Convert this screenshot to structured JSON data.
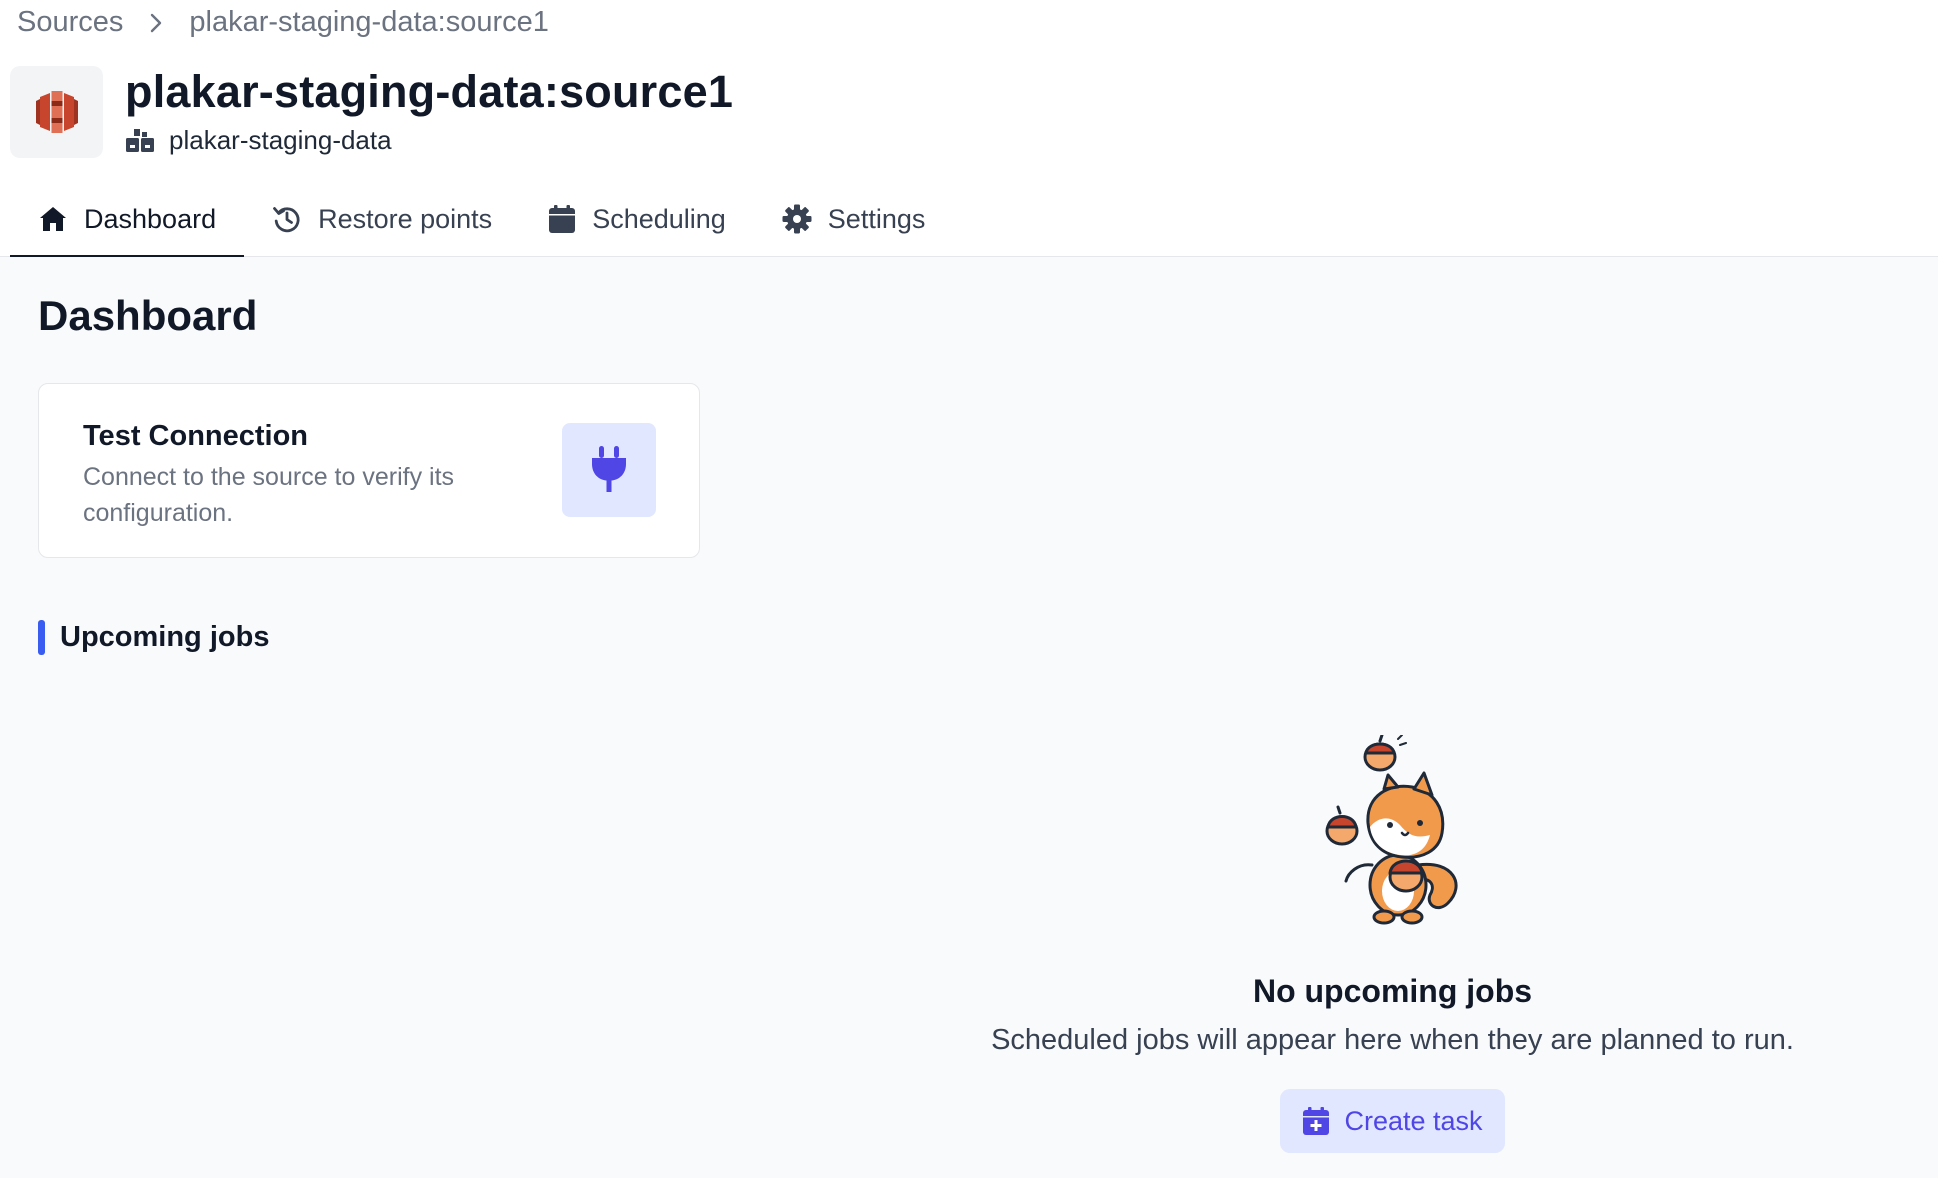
{
  "breadcrumb": {
    "root": "Sources",
    "current": "plakar-staging-data:source1"
  },
  "source": {
    "logo_icon": "aws-s3-icon",
    "title": "plakar-staging-data:source1",
    "store_icon": "store-icon",
    "store_name": "plakar-staging-data"
  },
  "tabs": [
    {
      "label": "Dashboard",
      "icon": "home-icon",
      "active": true
    },
    {
      "label": "Restore points",
      "icon": "history-icon",
      "active": false
    },
    {
      "label": "Scheduling",
      "icon": "calendar-icon",
      "active": false
    },
    {
      "label": "Settings",
      "icon": "gear-icon",
      "active": false
    }
  ],
  "main": {
    "title": "Dashboard",
    "test_connection": {
      "title": "Test Connection",
      "description": "Connect to the source to verify its configuration.",
      "icon": "plug-icon"
    },
    "upcoming": {
      "title": "Upcoming jobs",
      "empty_title": "No upcoming jobs",
      "empty_description": "Scheduled jobs will appear here when they are planned to run.",
      "create_label": "Create task",
      "create_icon": "calendar-plus-icon"
    }
  },
  "colors": {
    "accent": "#4f46e5",
    "accent_bg": "#e0e7ff",
    "section_bar": "#3b5cf0",
    "logo_red": "#c7452d"
  }
}
